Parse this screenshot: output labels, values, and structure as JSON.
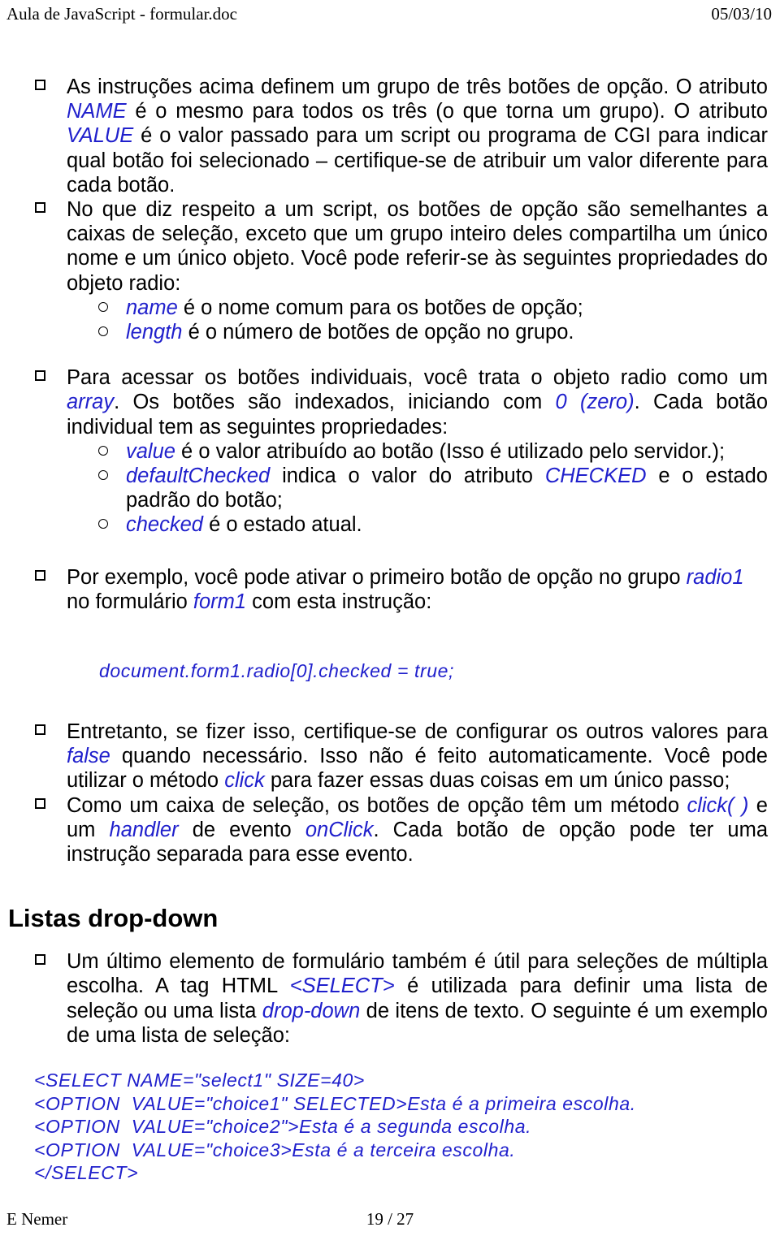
{
  "header": {
    "title": "Aula de JavaScript - formular.doc",
    "date": "05/03/10"
  },
  "footer": {
    "author": "E Nemer",
    "page": "19 / 27"
  },
  "colors": {
    "code_blue": "#2020cc",
    "text_black": "#000000",
    "page_background": "#ffffff"
  },
  "icons": {
    "bullet_square": "hollow-square-bullet",
    "bullet_circle": "hollow-circle-bullet"
  },
  "content": {
    "bullet1": {
      "p1": "As instruções acima definem um grupo de três botões de opção. O atributo ",
      "em1": "NAME",
      "p2": " é o mesmo para todos os três (o que torna um grupo). O atributo ",
      "em2": "VALUE",
      "p3": " é o valor passado para um script ou programa de CGI para indicar qual botão foi selecionado – certifique-se de atribuir um valor diferente para cada botão."
    },
    "bullet2": {
      "p1": "No que diz respeito a um script, os botões de opção são semelhantes a caixas de seleção, exceto que um grupo inteiro deles compartilha um único nome e um único objeto. Você pode referir-se às seguintes propriedades do objeto radio:"
    },
    "sub1": {
      "em1": "name",
      "p1": " é o nome comum para os botões de opção;"
    },
    "sub2": {
      "em1": "length",
      "p1": " é o número de botões de opção no grupo."
    },
    "bullet3": {
      "p1": "Para acessar os botões individuais, você trata o objeto radio como um ",
      "em1": "array",
      "p2": ". Os botões são indexados, iniciando com ",
      "em2": "0 (zero)",
      "p3": ". Cada botão individual tem as seguintes propriedades:"
    },
    "sub3": {
      "em1": "value",
      "p1": " é o valor atribuído ao botão (Isso é utilizado pelo servidor.);"
    },
    "sub4": {
      "em1": "defaultChecked",
      "p1": " indica o valor do atributo ",
      "em2": "CHECKED",
      "p2": " e o estado padrão do botão;"
    },
    "sub5": {
      "em1": "checked",
      "p1": " é o estado atual."
    },
    "bullet4": {
      "p1": "Por exemplo, você pode ativar o primeiro botão de opção no grupo ",
      "em1": "radio1",
      "p2": " no formulário ",
      "em2": "form1",
      "p3": " com esta instrução:"
    },
    "code_statement": "document.form1.radio[0].checked = true;",
    "bullet5": {
      "p1": "Entretanto, se fizer isso, certifique-se de configurar os outros valores para ",
      "em1": "false",
      "p2": " quando necessário. Isso não é feito automaticamente. Você pode utilizar o método ",
      "em2": "click",
      "p3": " para fazer essas duas coisas em um único passo;"
    },
    "bullet6": {
      "p1": "Como um caixa de seleção, os botões de opção têm um método ",
      "em1": "click( )",
      "p2": " e um ",
      "em2": "handler",
      "p3": " de evento ",
      "em3": "onClick",
      "p4": ". Cada botão de opção pode ter uma instrução separada para esse evento."
    },
    "heading": "Listas drop-down",
    "bullet7": {
      "p1": "Um último elemento de formulário também é útil para seleções de múltipla escolha. A tag HTML ",
      "em1": "<SELECT>",
      "p2": "  é utilizada para definir uma lista de seleção ou uma lista ",
      "em2": "drop-down",
      "p3": " de itens de texto. O seguinte é um exemplo de uma lista de seleção:"
    },
    "code_block": {
      "line1": "<SELECT NAME=\"select1\" SIZE=40>",
      "line2": "<OPTION  VALUE=\"choice1\" SELECTED>Esta é a primeira escolha.",
      "line3": "<OPTION  VALUE=\"choice2\">Esta é a segunda escolha.",
      "line4": "<OPTION  VALUE=\"choice3>Esta é a terceira escolha.",
      "line5": "</SELECT>"
    }
  }
}
